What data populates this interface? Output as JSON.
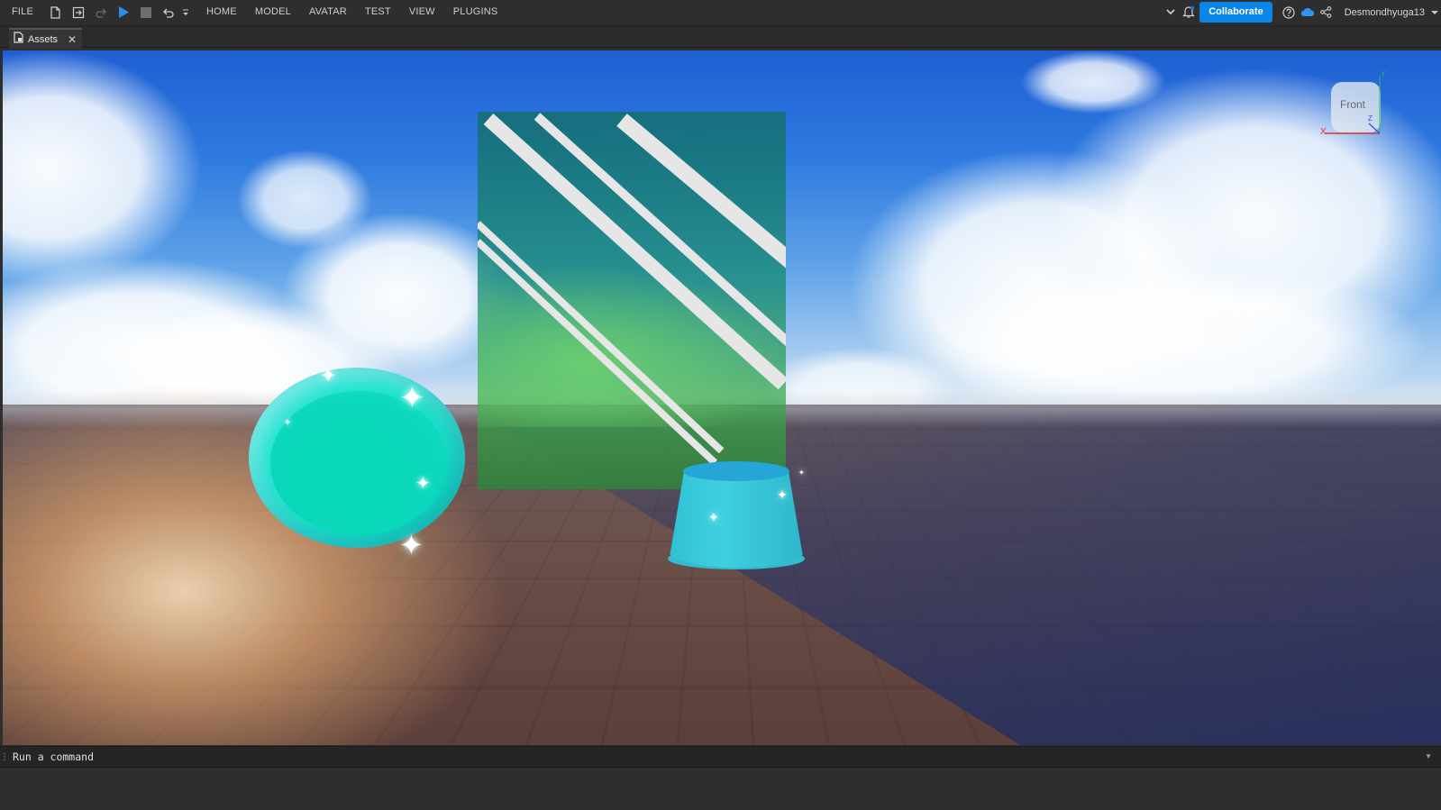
{
  "menubar": {
    "file": "FILE",
    "tabs": [
      "HOME",
      "MODEL",
      "AVATAR",
      "TEST",
      "VIEW",
      "PLUGINS"
    ],
    "collaborate": "Collaborate",
    "username": "Desmondhyuga13",
    "icons": [
      "new-file-icon",
      "open-place-icon",
      "redo-icon",
      "play-icon",
      "stop-icon",
      "undo-icon",
      "quick-access-dropdown-icon",
      "expand-chevron-icon",
      "notifications-icon",
      "help-icon",
      "cloud-icon",
      "share-icon",
      "user-dropdown-icon"
    ],
    "accent_color": "#0a85e8",
    "play_color": "#2b8cf0"
  },
  "tabstrip": {
    "active_tab": "Assets",
    "close_glyph": "✕"
  },
  "viewport": {
    "gizmo_label": "Front",
    "axes": {
      "x": "X",
      "y": "Y",
      "z": "Z"
    }
  },
  "command": {
    "placeholder": "Run a command"
  }
}
